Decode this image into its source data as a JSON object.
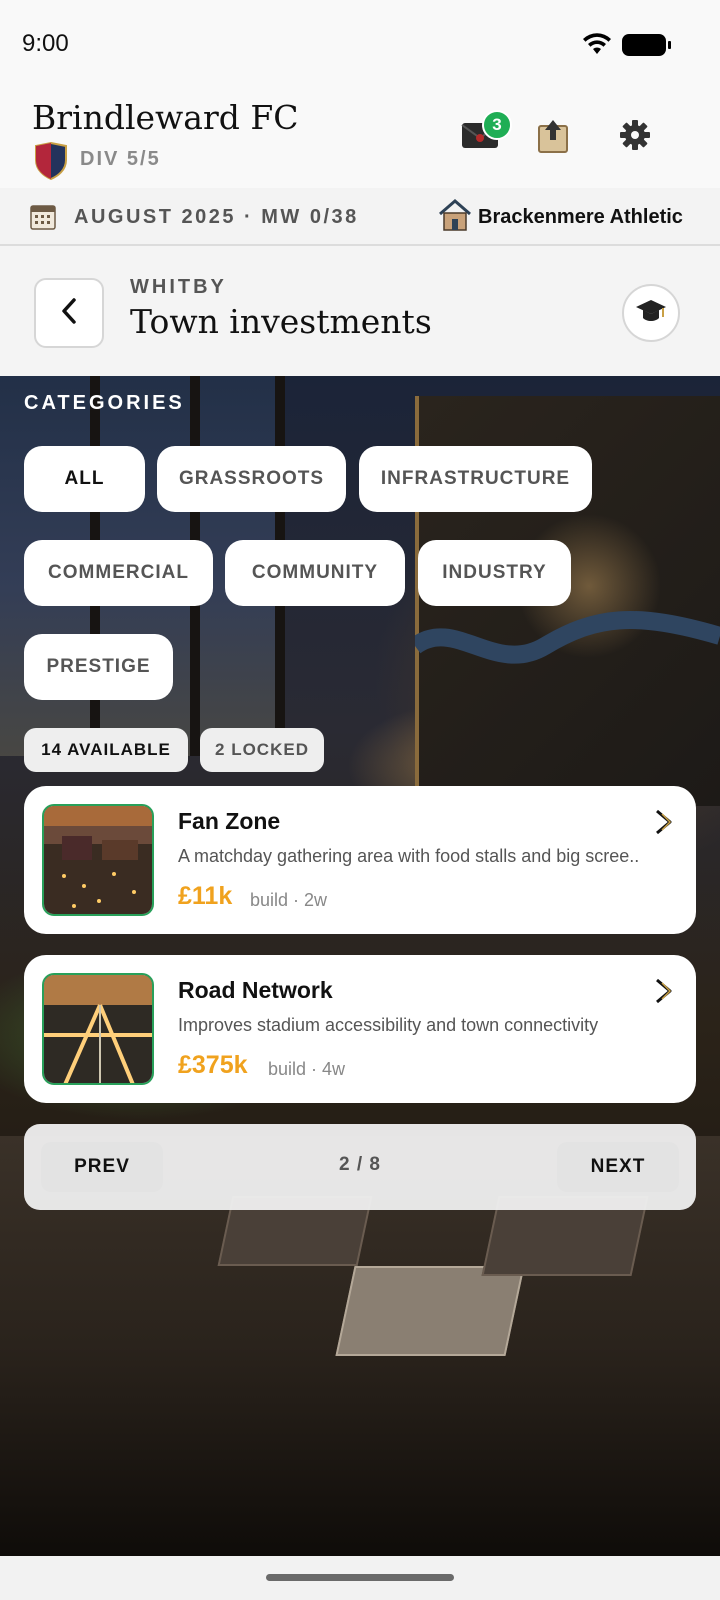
{
  "status_bar": {
    "time": "9:00"
  },
  "header": {
    "club_name": "Brindleward FC",
    "division": "DIV 5/5",
    "inbox_badge": "3"
  },
  "date_bar": {
    "date": "AUGUST 2025 · MW 0/38",
    "opponent": "Brackenmere Athletic"
  },
  "page": {
    "kicker": "WHITBY",
    "title": "Town investments"
  },
  "categories": {
    "label": "CATEGORIES",
    "items": [
      "ALL",
      "GRASSROOTS",
      "INFRASTRUCTURE",
      "COMMERCIAL",
      "COMMUNITY",
      "INDUSTRY",
      "PRESTIGE"
    ],
    "active": "ALL"
  },
  "counts": {
    "available": "14 AVAILABLE",
    "locked": "2 LOCKED"
  },
  "investments": [
    {
      "title": "Fan Zone",
      "description": "A matchday gathering area with food stalls and big scree..",
      "price": "£11k",
      "build": "build · 2w"
    },
    {
      "title": "Road Network",
      "description": "Improves stadium accessibility and town connectivity",
      "price": "£375k",
      "build": "build · 4w"
    }
  ],
  "pagination": {
    "prev": "PREV",
    "page": "2 / 8",
    "next": "NEXT"
  },
  "colors": {
    "accent_price": "#f0a21e",
    "badge_green": "#1fae55",
    "thumb_border": "#28a05a"
  }
}
